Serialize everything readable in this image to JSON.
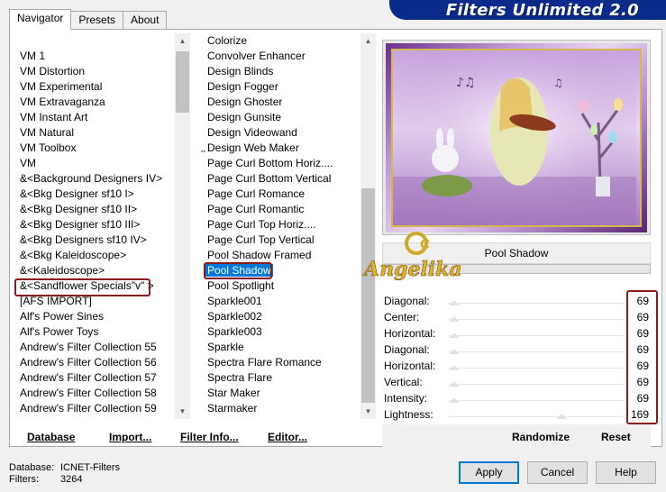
{
  "banner": {
    "title": "Filters Unlimited 2.0"
  },
  "tabs": [
    {
      "label": "Navigator"
    },
    {
      "label": "Presets"
    },
    {
      "label": "About"
    }
  ],
  "categories": [
    "VM 1",
    "VM Distortion",
    "VM Experimental",
    "VM Extravaganza",
    "VM Instant Art",
    "VM Natural",
    "VM Toolbox",
    "VM",
    "&<Background Designers IV>",
    "&<Bkg Designer sf10 I>",
    "&<Bkg Designer sf10 II>",
    "&<Bkg Designer sf10 III>",
    "&<Bkg Designers sf10 IV>",
    "&<Bkg Kaleidoscope>",
    "&<Kaleidoscope>",
    "&<Sandflower Specials\"v\" >",
    "[AFS IMPORT]",
    "Alf's Power Sines",
    "Alf's Power Toys",
    "Andrew's Filter Collection 55",
    "Andrew's Filter Collection 56",
    "Andrew's Filter Collection 57",
    "Andrew's Filter Collection 58",
    "Andrew's Filter Collection 59"
  ],
  "filters": [
    "Colorize",
    "Convolver Enhancer",
    "Design Blinds",
    "Design Fogger",
    "Design Ghoster",
    "Design Gunsite",
    "Design Videowand",
    "Design Web Maker",
    "Page Curl Bottom Horiz....",
    "Page Curl Bottom Vertical",
    "Page Curl Romance",
    "Page Curl Romantic",
    "Page Curl Top Horiz....",
    "Page Curl Top Vertical",
    "Pool Shadow Framed",
    "Pool Shadow",
    "Pool Spotlight",
    "Sparkle001",
    "Sparkle002",
    "Sparkle003",
    "Sparkle",
    "Spectra Flare Romance",
    "Spectra Flare",
    "Star Maker",
    "Starmaker"
  ],
  "selected_filter": "Pool Shadow",
  "watermark": "Angelika",
  "sliders": [
    {
      "label": "Diagonal:",
      "value": "69"
    },
    {
      "label": "Center:",
      "value": "69"
    },
    {
      "label": "Horizontal:",
      "value": "69"
    },
    {
      "label": "Diagonal:",
      "value": "69"
    },
    {
      "label": "Horizontal:",
      "value": "69"
    },
    {
      "label": "Vertical:",
      "value": "69"
    },
    {
      "label": "Intensity:",
      "value": "69"
    },
    {
      "label": "Lightness:",
      "value": "169"
    }
  ],
  "links": {
    "database": "Database",
    "import": "Import...",
    "filter_info": "Filter Info...",
    "editor": "Editor...",
    "randomize": "Randomize",
    "reset": "Reset"
  },
  "status": {
    "database_label": "Database:",
    "database_value": "ICNET-Filters",
    "filters_label": "Filters:",
    "filters_value": "3264"
  },
  "buttons": {
    "apply": "Apply",
    "cancel": "Cancel",
    "help": "Help"
  },
  "colors": {
    "banner": "#0a2a8c",
    "highlight_box": "#8b1a1a",
    "selection": "#0078d7"
  }
}
